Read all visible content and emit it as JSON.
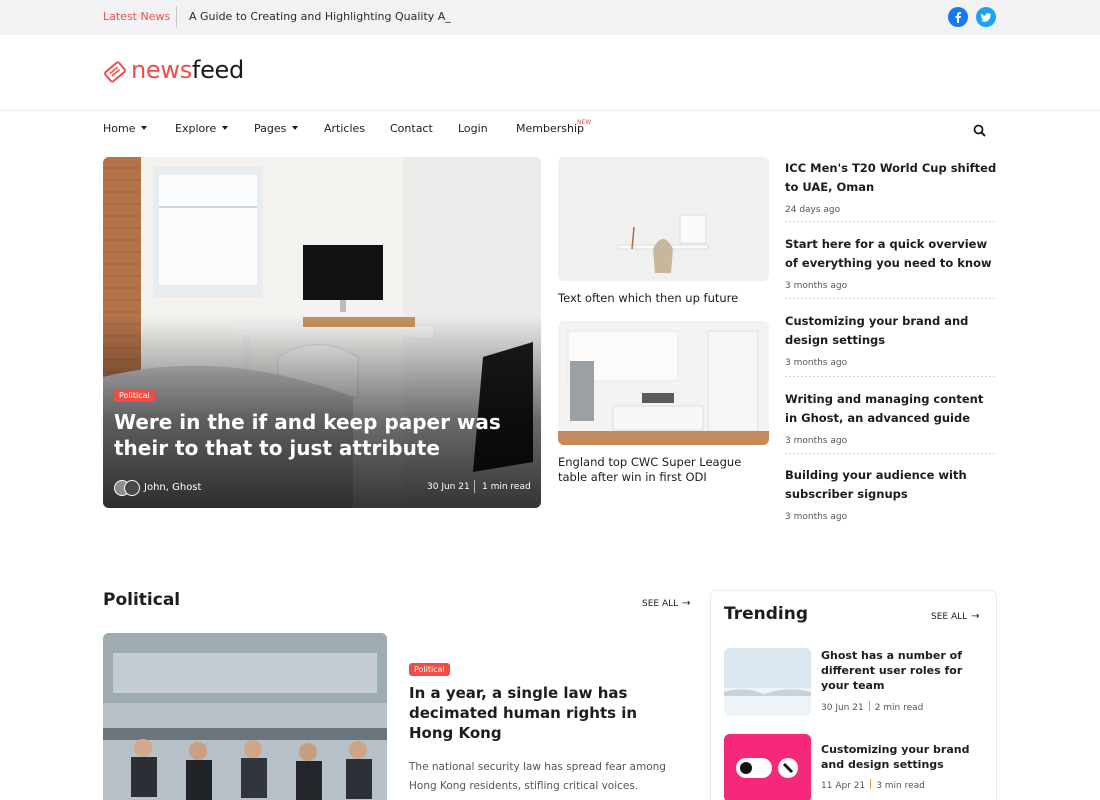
{
  "topbar": {
    "latest_label": "Latest News",
    "ticker_text": "A Guide to Creating and Highlighting Quality A_",
    "social": [
      {
        "icon": "facebook-icon",
        "color": "#1877f2"
      },
      {
        "icon": "twitter-icon",
        "color": "#1da1f2"
      }
    ]
  },
  "brand": {
    "name_part1": "news",
    "name_part2": "feed",
    "accent": "#ef4d45"
  },
  "nav": {
    "items": [
      {
        "label": "Home",
        "dropdown": true
      },
      {
        "label": "Explore",
        "dropdown": true
      },
      {
        "label": "Pages",
        "dropdown": true
      },
      {
        "label": "Articles",
        "dropdown": false
      },
      {
        "label": "Contact",
        "dropdown": false
      },
      {
        "label": "Login",
        "dropdown": false
      },
      {
        "label": "Membership",
        "dropdown": false
      }
    ],
    "new_badge": "NEW"
  },
  "hero": {
    "tag": "Political",
    "title": "Were in the if and keep paper was their to that to just attribute",
    "author": "John, Ghost",
    "date": "30 Jun 21",
    "read_time": "1 min read"
  },
  "middle_cards": [
    {
      "title": "Text often which then up future"
    },
    {
      "title": "England top CWC Super League table after win in first ODI"
    }
  ],
  "right_list": [
    {
      "title": "ICC Men's T20 World Cup shifted to UAE, Oman",
      "time": "24 days ago"
    },
    {
      "title": "Start here for a quick overview of everything you need to know",
      "time": "3 months ago"
    },
    {
      "title": "Customizing your brand and design settings",
      "time": "3 months ago"
    },
    {
      "title": "Writing and managing content in Ghost, an advanced guide",
      "time": "3 months ago"
    },
    {
      "title": "Building your audience with subscriber signups",
      "time": "3 months ago"
    }
  ],
  "political": {
    "heading": "Political",
    "see_all": "SEE ALL",
    "article": {
      "tag": "Political",
      "title": "In a year, a single law has decimated human rights in Hong Kong",
      "excerpt": "The national security law has spread fear among Hong Kong residents, stifling critical voices."
    }
  },
  "trending": {
    "heading": "Trending",
    "see_all": "SEE ALL",
    "items": [
      {
        "title": "Ghost has a number of different user roles for your team",
        "date": "30 Jun 21",
        "read_time": "2 min read"
      },
      {
        "title": "Customizing your brand and design settings",
        "date": "11 Apr 21",
        "read_time": "3 min read"
      }
    ]
  }
}
